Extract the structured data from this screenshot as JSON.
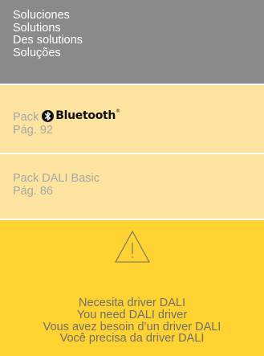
{
  "header": {
    "lines": [
      "Soluciones",
      "Solutions",
      "Des solutions",
      "Soluções"
    ]
  },
  "pack_bluetooth": {
    "pack_label": "Pack",
    "brand": "Bluetooth",
    "trademark": "®",
    "page": "Pág. 92"
  },
  "pack_dali": {
    "title": "Pack DALI Basic",
    "page": "Pág. 86"
  },
  "warning": {
    "icon": "warning-triangle-icon",
    "lines": [
      "Necesita driver DALI",
      "You need DALI driver",
      "Vous avez besoin d’un driver DALI",
      "Você precisa da driver DALI"
    ]
  },
  "colors": {
    "header_bg": "#8a8a8a",
    "pack_bg": "#fde3a0",
    "warning_bg": "#fdd231",
    "muted_text": "#a7a7a7"
  }
}
